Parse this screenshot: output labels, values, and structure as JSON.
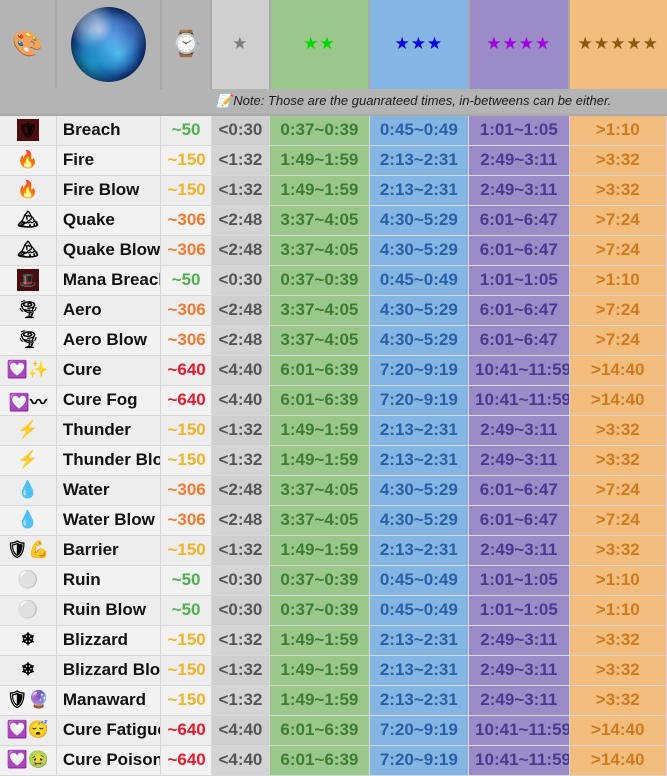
{
  "header": {
    "palette_icon": "🎨",
    "orb_label": "blue-orb-image",
    "watch_icon": "⌚",
    "tiers": [
      {
        "name": "tier-1",
        "stars": "★",
        "color": "#7d7d7d",
        "bg": "#cfcfcf"
      },
      {
        "name": "tier-2",
        "stars": "★★",
        "color": "#00d800",
        "bg": "#9ac88a"
      },
      {
        "name": "tier-3",
        "stars": "★★★",
        "color": "#0000e0",
        "bg": "#85b6e3"
      },
      {
        "name": "tier-4",
        "stars": "★★★★",
        "color": "#a000e0",
        "bg": "#9b8cc8"
      },
      {
        "name": "tier-5",
        "stars": "★★★★★",
        "color": "#8a5a10",
        "bg": "#f3bd7e"
      }
    ]
  },
  "note": {
    "icon": "📝",
    "text": "Note: Those are the guanrateed times, in-betweens can be either."
  },
  "colors": {
    "num_50": "#4fb14f",
    "num_150": "#f0b429",
    "num_306": "#f07a30",
    "num_640": "#e01b2e"
  },
  "rows": [
    {
      "icons": "🛡",
      "icon_style": "badge",
      "name": "Breach",
      "num": "~50",
      "num_key": "num_50",
      "t1": "<0:30",
      "t2": "0:37~0:39",
      "t3": "0:45~0:49",
      "t4": "1:01~1:05",
      "t5": ">1:10"
    },
    {
      "icons": "🔥",
      "icon_style": "plain",
      "name": "Fire",
      "num": "~150",
      "num_key": "num_150",
      "t1": "<1:32",
      "t2": "1:49~1:59",
      "t3": "2:13~2:31",
      "t4": "2:49~3:11",
      "t5": ">3:32"
    },
    {
      "icons": "🔥",
      "icon_style": "plain",
      "name": "Fire Blow",
      "num": "~150",
      "num_key": "num_150",
      "t1": "<1:32",
      "t2": "1:49~1:59",
      "t3": "2:13~2:31",
      "t4": "2:49~3:11",
      "t5": ">3:32"
    },
    {
      "icons": "🏔",
      "icon_style": "plain",
      "name": "Quake",
      "num": "~306",
      "num_key": "num_306",
      "t1": "<2:48",
      "t2": "3:37~4:05",
      "t3": "4:30~5:29",
      "t4": "6:01~6:47",
      "t5": ">7:24"
    },
    {
      "icons": "🏔",
      "icon_style": "plain",
      "name": "Quake Blow",
      "num": "~306",
      "num_key": "num_306",
      "t1": "<2:48",
      "t2": "3:37~4:05",
      "t3": "4:30~5:29",
      "t4": "6:01~6:47",
      "t5": ">7:24"
    },
    {
      "icons": "🎩",
      "icon_style": "badge",
      "name": "Mana Breach",
      "num": "~50",
      "num_key": "num_50",
      "t1": "<0:30",
      "t2": "0:37~0:39",
      "t3": "0:45~0:49",
      "t4": "1:01~1:05",
      "t5": ">1:10"
    },
    {
      "icons": "🌪",
      "icon_style": "plain",
      "name": "Aero",
      "num": "~306",
      "num_key": "num_306",
      "t1": "<2:48",
      "t2": "3:37~4:05",
      "t3": "4:30~5:29",
      "t4": "6:01~6:47",
      "t5": ">7:24"
    },
    {
      "icons": "🌪",
      "icon_style": "plain",
      "name": "Aero Blow",
      "num": "~306",
      "num_key": "num_306",
      "t1": "<2:48",
      "t2": "3:37~4:05",
      "t3": "4:30~5:29",
      "t4": "6:01~6:47",
      "t5": ">7:24"
    },
    {
      "icons": "💟✨",
      "icon_style": "plain",
      "name": "Cure",
      "num": "~640",
      "num_key": "num_640",
      "t1": "<4:40",
      "t2": "6:01~6:39",
      "t3": "7:20~9:19",
      "t4": "10:41~11:59",
      "t5": ">14:40"
    },
    {
      "icons": "💟〰",
      "icon_style": "plain",
      "name": "Cure Fog",
      "num": "~640",
      "num_key": "num_640",
      "t1": "<4:40",
      "t2": "6:01~6:39",
      "t3": "7:20~9:19",
      "t4": "10:41~11:59",
      "t5": ">14:40"
    },
    {
      "icons": "⚡",
      "icon_style": "plain",
      "name": "Thunder",
      "num": "~150",
      "num_key": "num_150",
      "t1": "<1:32",
      "t2": "1:49~1:59",
      "t3": "2:13~2:31",
      "t4": "2:49~3:11",
      "t5": ">3:32"
    },
    {
      "icons": "⚡",
      "icon_style": "plain",
      "name": "Thunder Blow",
      "num": "~150",
      "num_key": "num_150",
      "t1": "<1:32",
      "t2": "1:49~1:59",
      "t3": "2:13~2:31",
      "t4": "2:49~3:11",
      "t5": ">3:32"
    },
    {
      "icons": "💧",
      "icon_style": "plain",
      "name": "Water",
      "num": "~306",
      "num_key": "num_306",
      "t1": "<2:48",
      "t2": "3:37~4:05",
      "t3": "4:30~5:29",
      "t4": "6:01~6:47",
      "t5": ">7:24"
    },
    {
      "icons": "💧",
      "icon_style": "plain",
      "name": "Water Blow",
      "num": "~306",
      "num_key": "num_306",
      "t1": "<2:48",
      "t2": "3:37~4:05",
      "t3": "4:30~5:29",
      "t4": "6:01~6:47",
      "t5": ">7:24"
    },
    {
      "icons": "🛡💪",
      "icon_style": "plain",
      "name": "Barrier",
      "num": "~150",
      "num_key": "num_150",
      "t1": "<1:32",
      "t2": "1:49~1:59",
      "t3": "2:13~2:31",
      "t4": "2:49~3:11",
      "t5": ">3:32"
    },
    {
      "icons": "⚪",
      "icon_style": "plain",
      "name": "Ruin",
      "num": "~50",
      "num_key": "num_50",
      "t1": "<0:30",
      "t2": "0:37~0:39",
      "t3": "0:45~0:49",
      "t4": "1:01~1:05",
      "t5": ">1:10"
    },
    {
      "icons": "⚪",
      "icon_style": "plain",
      "name": "Ruin Blow",
      "num": "~50",
      "num_key": "num_50",
      "t1": "<0:30",
      "t2": "0:37~0:39",
      "t3": "0:45~0:49",
      "t4": "1:01~1:05",
      "t5": ">1:10"
    },
    {
      "icons": "❄",
      "icon_style": "plain",
      "name": "Blizzard",
      "num": "~150",
      "num_key": "num_150",
      "t1": "<1:32",
      "t2": "1:49~1:59",
      "t3": "2:13~2:31",
      "t4": "2:49~3:11",
      "t5": ">3:32"
    },
    {
      "icons": "❄",
      "icon_style": "plain",
      "name": "Blizzard Blow",
      "num": "~150",
      "num_key": "num_150",
      "t1": "<1:32",
      "t2": "1:49~1:59",
      "t3": "2:13~2:31",
      "t4": "2:49~3:11",
      "t5": ">3:32"
    },
    {
      "icons": "🛡🔮",
      "icon_style": "plain",
      "name": "Manaward",
      "num": "~150",
      "num_key": "num_150",
      "t1": "<1:32",
      "t2": "1:49~1:59",
      "t3": "2:13~2:31",
      "t4": "2:49~3:11",
      "t5": ">3:32"
    },
    {
      "icons": "💟😴",
      "icon_style": "plain",
      "name": "Cure Fatigue",
      "num": "~640",
      "num_key": "num_640",
      "t1": "<4:40",
      "t2": "6:01~6:39",
      "t3": "7:20~9:19",
      "t4": "10:41~11:59",
      "t5": ">14:40"
    },
    {
      "icons": "💟🤢",
      "icon_style": "plain",
      "name": "Cure Poison",
      "num": "~640",
      "num_key": "num_640",
      "t1": "<4:40",
      "t2": "6:01~6:39",
      "t3": "7:20~9:19",
      "t4": "10:41~11:59",
      "t5": ">14:40"
    }
  ]
}
